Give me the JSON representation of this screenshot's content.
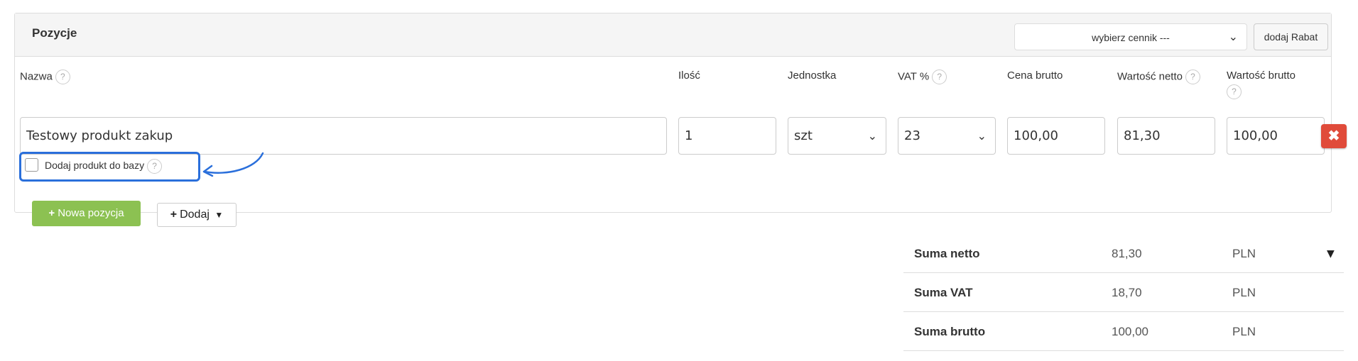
{
  "panel": {
    "title": "Pozycje",
    "cennik_select": "wybierz cennik ---",
    "rabat_button": "dodaj Rabat"
  },
  "columns": {
    "nazwa": "Nazwa",
    "ilosc": "Ilość",
    "jednostka": "Jednostka",
    "vat": "VAT %",
    "cena_brutto": "Cena brutto",
    "wartosc_netto": "Wartość netto",
    "wartosc_brutto": "Wartość brutto",
    "help": "?"
  },
  "row": {
    "nazwa": "Testowy produkt zakup",
    "ilosc": "1",
    "jednostka": "szt",
    "vat": "23",
    "cena_brutto": "100,00",
    "wartosc_netto": "81,30",
    "wartosc_brutto": "100,00",
    "delete_icon": "✖",
    "add_to_db_label": "Dodaj produkt do bazy"
  },
  "actions": {
    "nowa_pozycja": "Nowa pozycja",
    "dodaj": "Dodaj"
  },
  "summary": [
    {
      "label": "Suma netto",
      "value": "81,30",
      "currency": "PLN"
    },
    {
      "label": "Suma VAT",
      "value": "18,70",
      "currency": "PLN"
    },
    {
      "label": "Suma brutto",
      "value": "100,00",
      "currency": "PLN"
    }
  ],
  "colors": {
    "accent_green": "#8cc152",
    "delete_red": "#e04b3a",
    "highlight_blue": "#2a6fdb"
  }
}
